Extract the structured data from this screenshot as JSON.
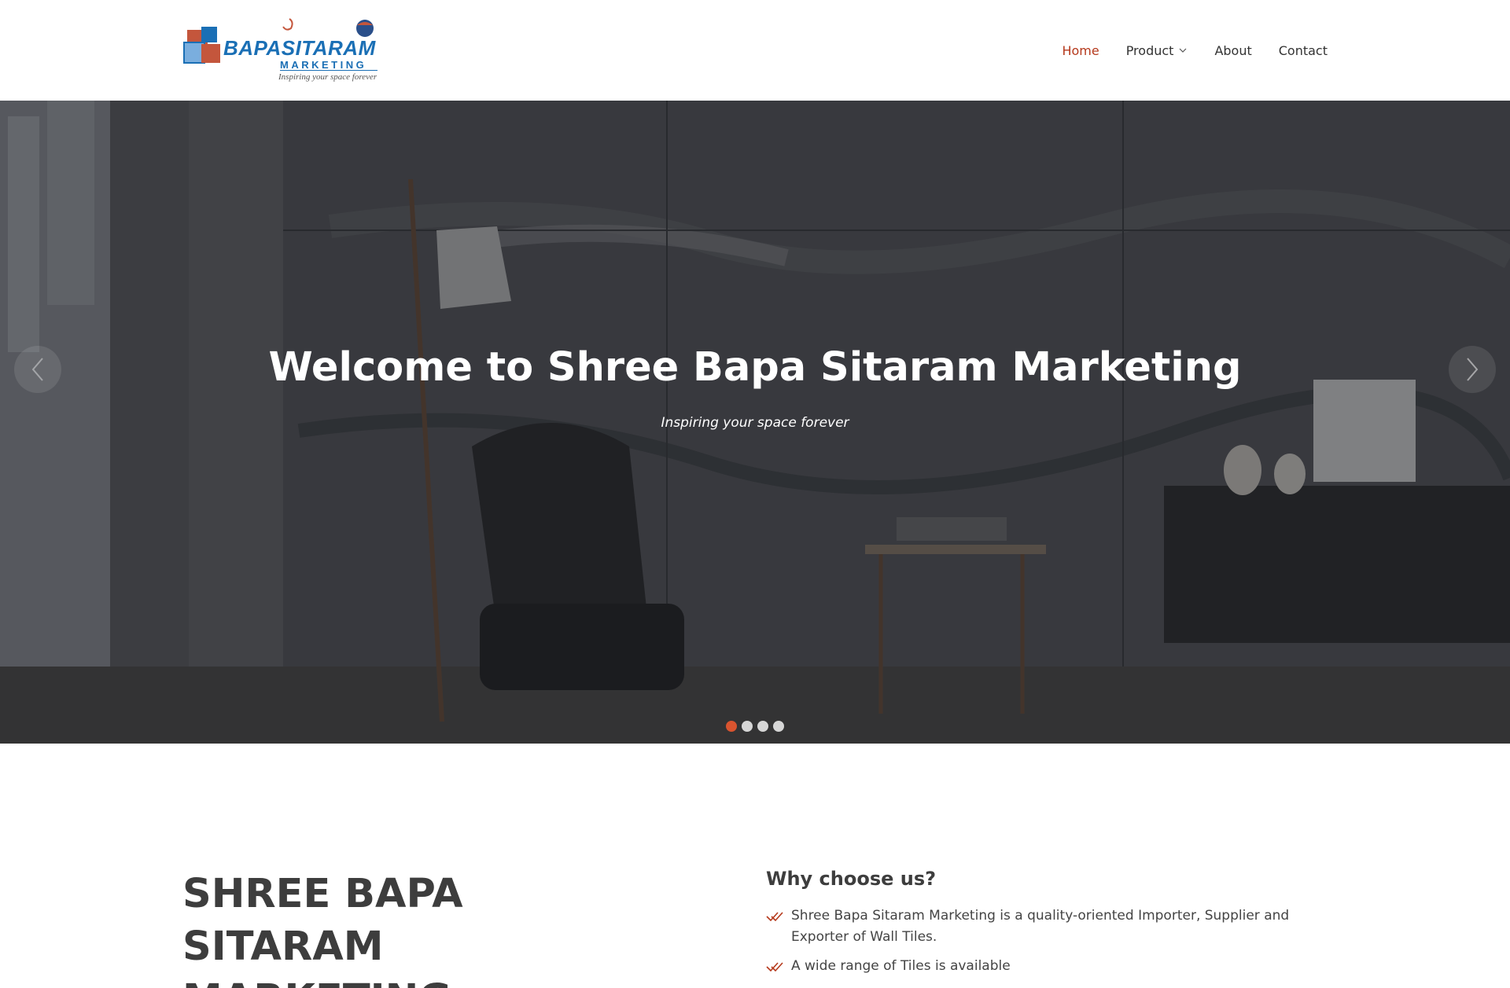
{
  "header": {
    "logo": {
      "brand": "BAPASITARAM",
      "subtitle": "MARKETING",
      "tagline": "Inspiring your space forever"
    },
    "nav": [
      {
        "label": "Home",
        "active": true
      },
      {
        "label": "Product",
        "has_dropdown": true
      },
      {
        "label": "About"
      },
      {
        "label": "Contact"
      }
    ]
  },
  "hero": {
    "title": "Welcome to Shree Bapa Sitaram Marketing",
    "subtitle": "Inspiring your space forever",
    "prev_icon": "chevron-left-icon",
    "next_icon": "chevron-right-icon",
    "slides_total": 4,
    "active_slide": 1
  },
  "about": {
    "title_line1": "SHREE BAPA SITARAM",
    "title_line2": "MARKETING"
  },
  "why_choose": {
    "heading": "Why choose us?",
    "items": [
      "Shree Bapa Sitaram Marketing is a quality-oriented Importer, Supplier and Exporter of Wall Tiles.",
      "A wide range of Tiles is available"
    ]
  },
  "colors": {
    "accent": "#b5391c",
    "brand_blue": "#1a6fb5",
    "dot_active": "#d9542f"
  }
}
